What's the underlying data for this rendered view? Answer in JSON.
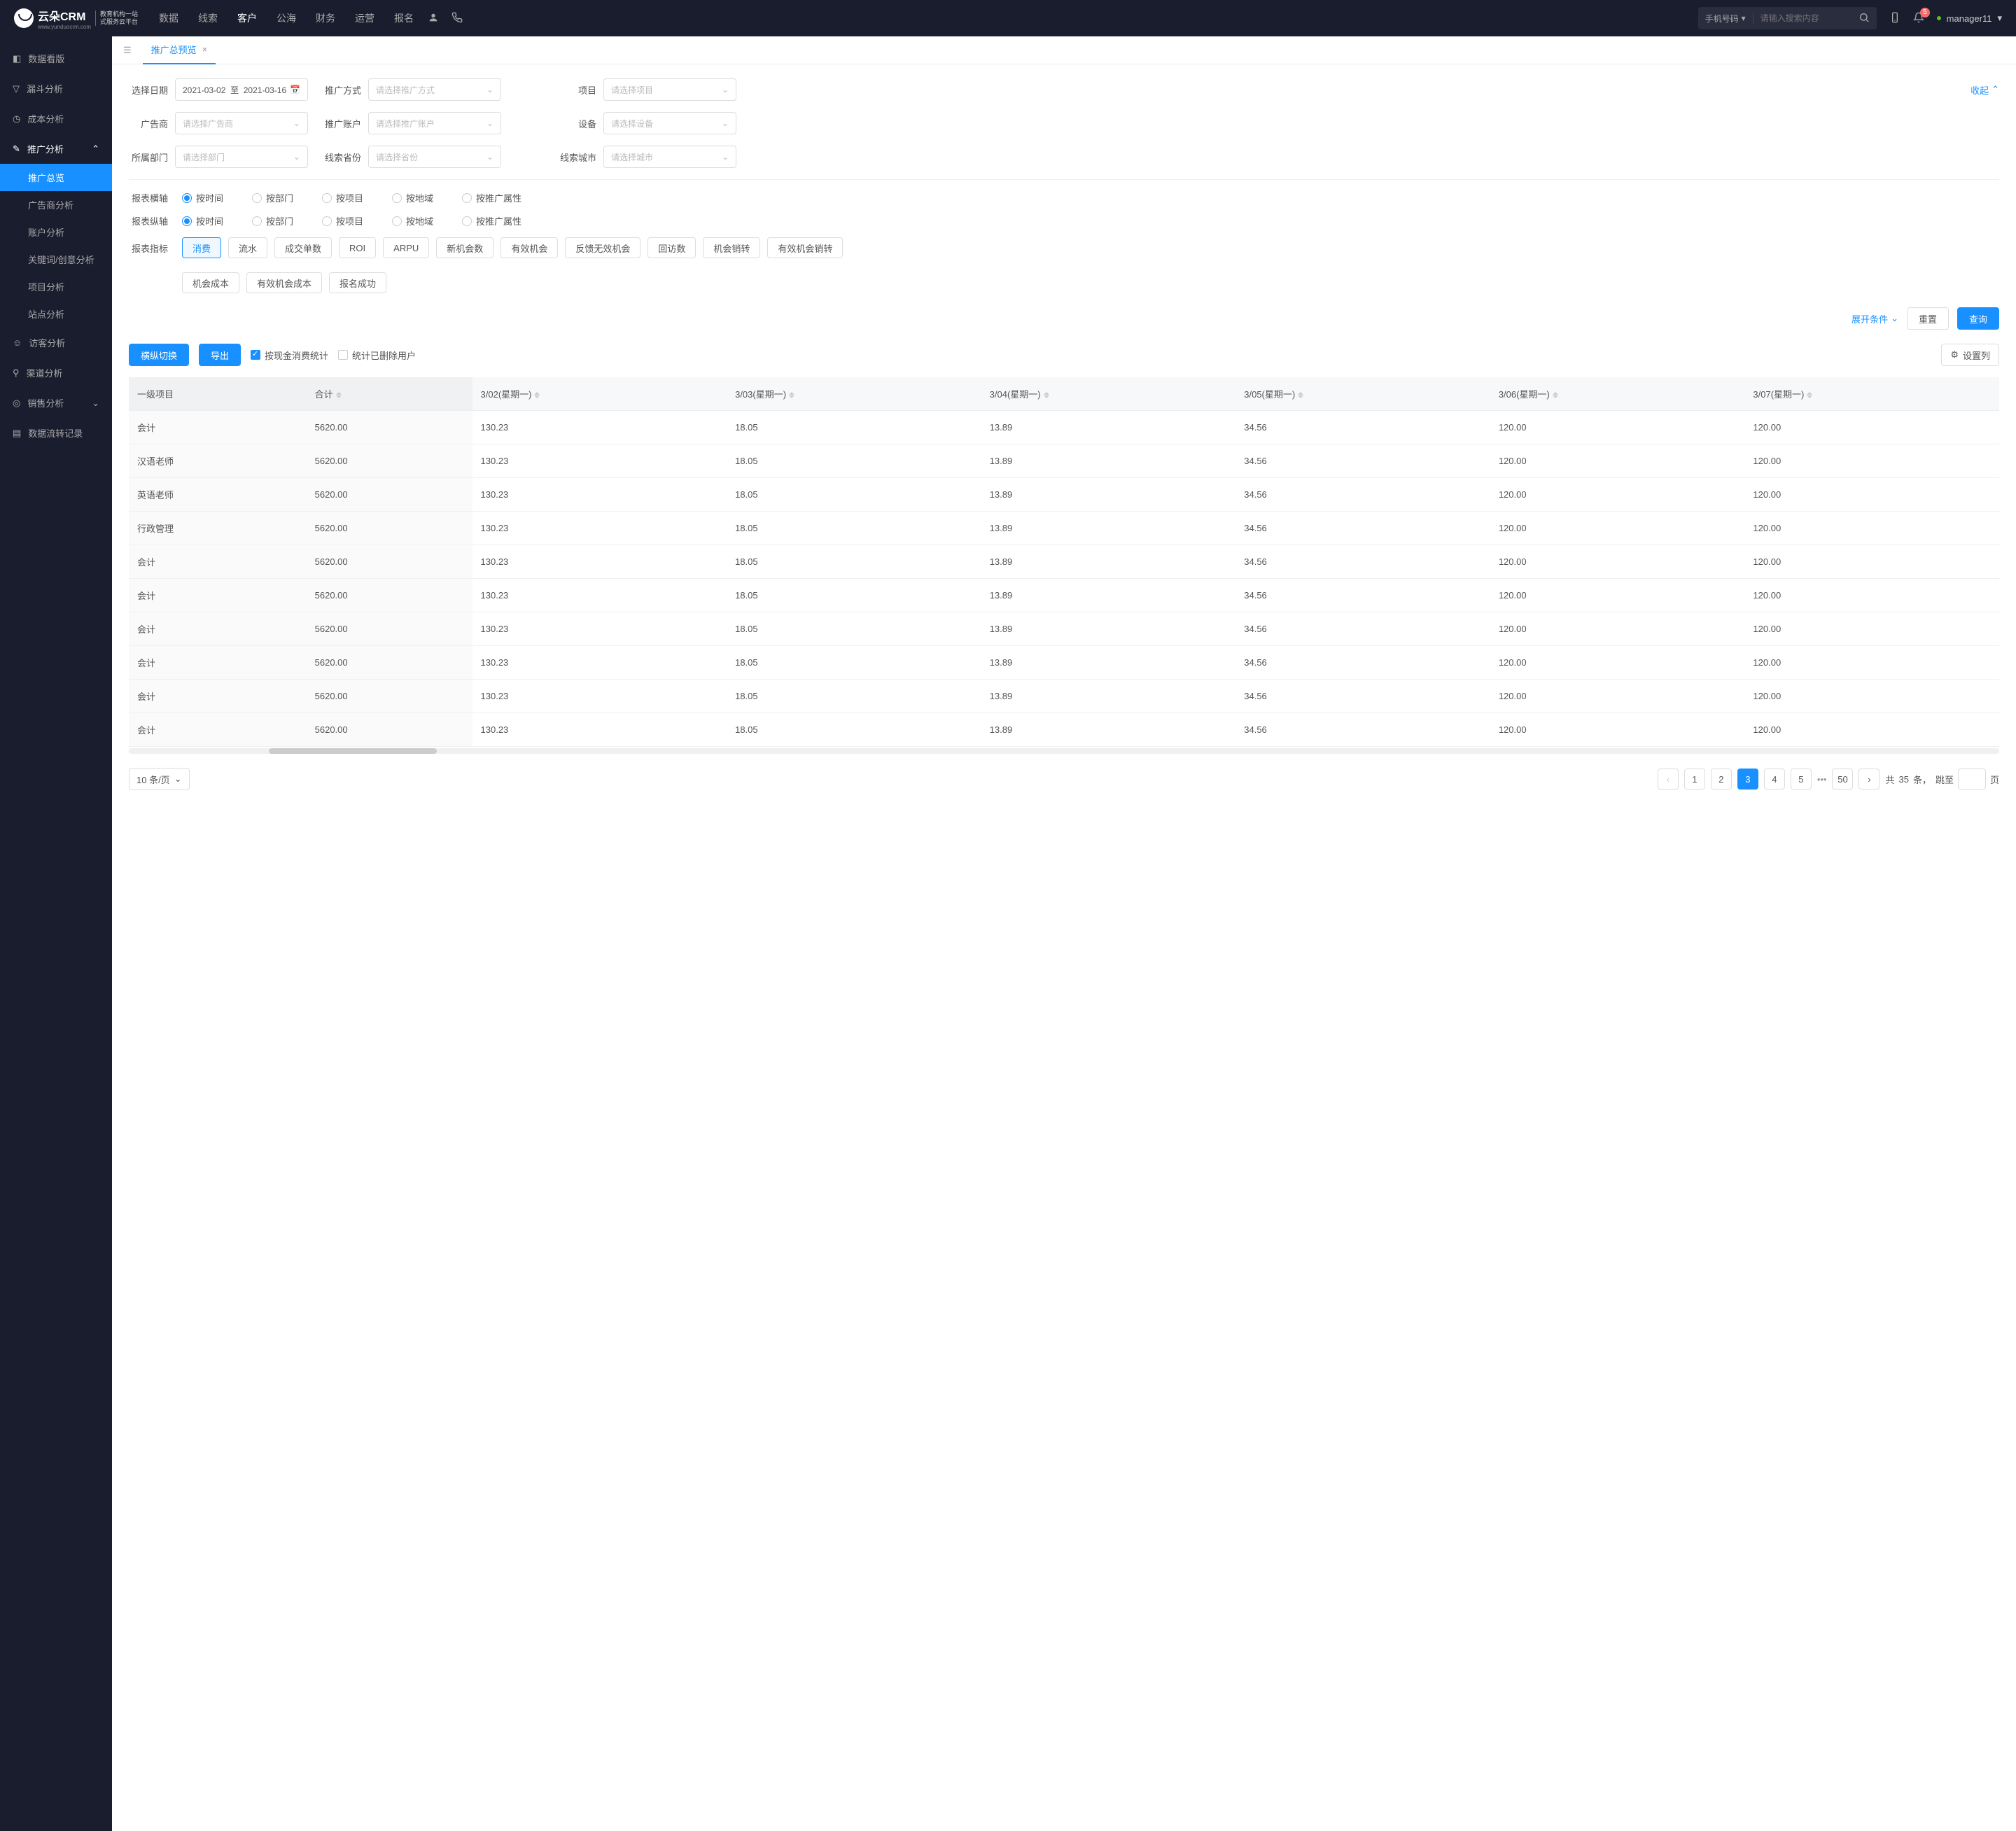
{
  "header": {
    "logo_text": "云朵CRM",
    "logo_sub1": "教育机构一站",
    "logo_sub2": "式服务云平台",
    "logo_url": "www.yunduocrm.com",
    "nav": [
      "数据",
      "线索",
      "客户",
      "公海",
      "财务",
      "运营",
      "报名"
    ],
    "nav_active_index": 2,
    "search_type": "手机号码",
    "search_placeholder": "请输入搜索内容",
    "badge_count": "5",
    "username": "manager11"
  },
  "sidebar": {
    "items": [
      {
        "icon": "dashboard",
        "label": "数据看版"
      },
      {
        "icon": "funnel",
        "label": "漏斗分析"
      },
      {
        "icon": "cost",
        "label": "成本分析"
      },
      {
        "icon": "promo",
        "label": "推广分析",
        "expanded": true,
        "children": [
          {
            "label": "推广总览",
            "active": true
          },
          {
            "label": "广告商分析"
          },
          {
            "label": "账户分析"
          },
          {
            "label": "关键词/创意分析"
          },
          {
            "label": "项目分析"
          },
          {
            "label": "站点分析"
          }
        ]
      },
      {
        "icon": "visitor",
        "label": "访客分析"
      },
      {
        "icon": "channel",
        "label": "渠道分析"
      },
      {
        "icon": "sales",
        "label": "销售分析",
        "caret": true
      },
      {
        "icon": "flow",
        "label": "数据流转记录"
      }
    ]
  },
  "tab": {
    "title": "推广总预览"
  },
  "filters": {
    "date_label": "选择日期",
    "date_from": "2021-03-02",
    "date_sep": "至",
    "date_to": "2021-03-16",
    "method_label": "推广方式",
    "method_placeholder": "请选择推广方式",
    "project_label": "项目",
    "project_placeholder": "请选择项目",
    "advertiser_label": "广告商",
    "advertiser_placeholder": "请选择广告商",
    "account_label": "推广账户",
    "account_placeholder": "请选择推广账户",
    "device_label": "设备",
    "device_placeholder": "请选择设备",
    "department_label": "所属部门",
    "department_placeholder": "请选择部门",
    "province_label": "线索省份",
    "province_placeholder": "请选择省份",
    "city_label": "线索城市",
    "city_placeholder": "请选择城市",
    "collapse": "收起"
  },
  "axis": {
    "h_label": "报表横轴",
    "v_label": "报表纵轴",
    "options": [
      "按时间",
      "按部门",
      "按项目",
      "按地域",
      "按推广属性"
    ],
    "h_selected": 0,
    "v_selected": 0
  },
  "metrics": {
    "label": "报表指标",
    "row1": [
      "消费",
      "流水",
      "成交单数",
      "ROI",
      "ARPU",
      "新机会数",
      "有效机会",
      "反馈无效机会",
      "回访数",
      "机会销转",
      "有效机会销转"
    ],
    "row2": [
      "机会成本",
      "有效机会成本",
      "报名成功"
    ],
    "active_index": 0
  },
  "actions": {
    "expand": "展开条件",
    "reset": "重置",
    "query": "查询"
  },
  "toolbar": {
    "switch": "横纵切换",
    "export": "导出",
    "cash_stat": "按现金消费统计",
    "deleted_user": "统计已删除用户",
    "settings": "设置列"
  },
  "table": {
    "col_fixed1": "一级项目",
    "col_fixed2": "合计",
    "cols": [
      "3/02(星期一)",
      "3/03(星期一)",
      "3/04(星期一)",
      "3/05(星期一)",
      "3/06(星期一)",
      "3/07(星期一)"
    ],
    "rows": [
      {
        "name": "会计",
        "total": "5620.00",
        "cells": [
          "130.23",
          "18.05",
          "13.89",
          "34.56",
          "120.00",
          "120.00"
        ]
      },
      {
        "name": "汉语老师",
        "total": "5620.00",
        "cells": [
          "130.23",
          "18.05",
          "13.89",
          "34.56",
          "120.00",
          "120.00"
        ]
      },
      {
        "name": "英语老师",
        "total": "5620.00",
        "cells": [
          "130.23",
          "18.05",
          "13.89",
          "34.56",
          "120.00",
          "120.00"
        ]
      },
      {
        "name": "行政管理",
        "total": "5620.00",
        "cells": [
          "130.23",
          "18.05",
          "13.89",
          "34.56",
          "120.00",
          "120.00"
        ]
      },
      {
        "name": "会计",
        "total": "5620.00",
        "cells": [
          "130.23",
          "18.05",
          "13.89",
          "34.56",
          "120.00",
          "120.00"
        ]
      },
      {
        "name": "会计",
        "total": "5620.00",
        "cells": [
          "130.23",
          "18.05",
          "13.89",
          "34.56",
          "120.00",
          "120.00"
        ]
      },
      {
        "name": "会计",
        "total": "5620.00",
        "cells": [
          "130.23",
          "18.05",
          "13.89",
          "34.56",
          "120.00",
          "120.00"
        ]
      },
      {
        "name": "会计",
        "total": "5620.00",
        "cells": [
          "130.23",
          "18.05",
          "13.89",
          "34.56",
          "120.00",
          "120.00"
        ]
      },
      {
        "name": "会计",
        "total": "5620.00",
        "cells": [
          "130.23",
          "18.05",
          "13.89",
          "34.56",
          "120.00",
          "120.00"
        ]
      },
      {
        "name": "会计",
        "total": "5620.00",
        "cells": [
          "130.23",
          "18.05",
          "13.89",
          "34.56",
          "120.00",
          "120.00"
        ]
      }
    ]
  },
  "pagination": {
    "page_size": "10 条/页",
    "pages": [
      "1",
      "2",
      "3",
      "4",
      "5"
    ],
    "last": "50",
    "active": 2,
    "total_prefix": "共",
    "total": "35",
    "total_suffix": "条，",
    "jump_prefix": "跳至",
    "jump_suffix": "页"
  }
}
